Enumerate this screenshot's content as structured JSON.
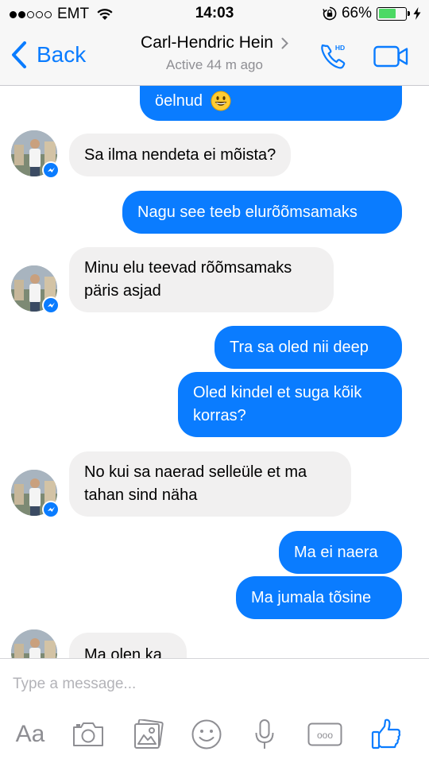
{
  "status_bar": {
    "carrier": "EMT",
    "time": "14:03",
    "battery_text": "66%",
    "battery_level": 0.66,
    "icons": [
      "signal-dots-icon",
      "wifi-icon",
      "rotation-lock-icon",
      "battery-icon",
      "charging-bolt-icon"
    ]
  },
  "nav": {
    "back_label": "Back",
    "contact_name": "Carl-Hendric Hein",
    "contact_status": "Active 44 m ago",
    "call_icon_text": "HD",
    "icons": [
      "chevron-left-icon",
      "chevron-right-icon",
      "phone-hd-icon",
      "video-camera-icon"
    ]
  },
  "messages": [
    {
      "direction": "out",
      "text": "öelnud",
      "emoji": "grinning-emoji"
    },
    {
      "direction": "in",
      "text": "Sa ilma nendeta ei mõista?"
    },
    {
      "direction": "out",
      "text": "Nagu see teeb elurõõmsamaks"
    },
    {
      "direction": "in",
      "lines": [
        "Minu elu teevad rõõmsamaks",
        "päris asjad"
      ]
    },
    {
      "direction": "out",
      "text": "Tra sa oled nii deep"
    },
    {
      "direction": "out",
      "lines": [
        "Oled kindel et suga kõik",
        "korras?"
      ]
    },
    {
      "direction": "in",
      "lines": [
        "No kui sa naerad selleüle et ma",
        "tahan sind näha"
      ]
    },
    {
      "direction": "out",
      "text": "Ma ei naera"
    },
    {
      "direction": "out",
      "text": "Ma jumala tõsine"
    },
    {
      "direction": "in",
      "text": "Ma olen ka"
    }
  ],
  "composer": {
    "placeholder": "Type a message...",
    "aa_label": "Aa",
    "more_label": "ooo",
    "tools": [
      "text-format-icon",
      "camera-icon",
      "photo-gallery-icon",
      "emoji-icon",
      "microphone-icon",
      "more-icon",
      "thumbs-up-icon"
    ]
  },
  "colors": {
    "accent": "#0a7cff",
    "incoming_bubble": "#f1f0f0",
    "bar_background": "#f7f7f7",
    "secondary_text": "#8e8e93",
    "battery_green": "#4cd964"
  }
}
